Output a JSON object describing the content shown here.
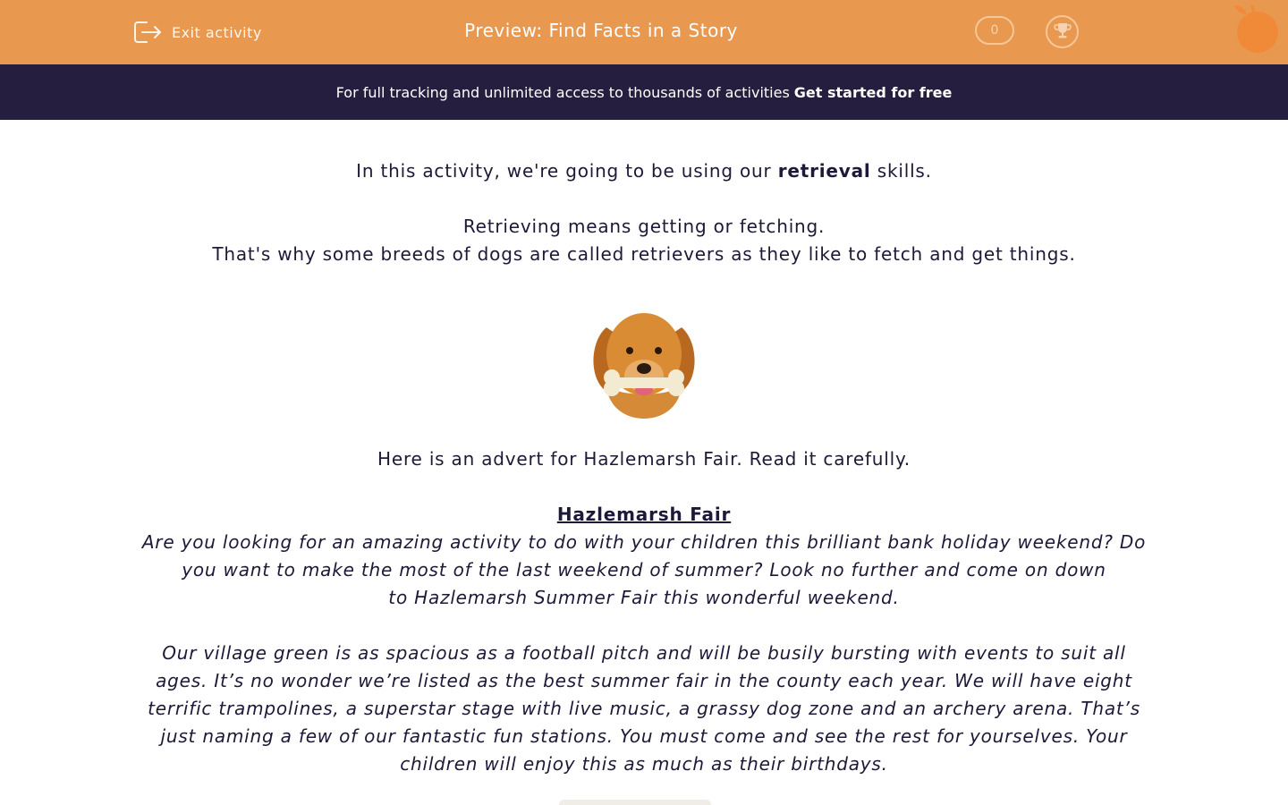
{
  "header": {
    "exit_label": "Exit activity",
    "title": "Preview: Find Facts in a Story",
    "score": "0"
  },
  "banner": {
    "text": "For full tracking and unlimited access to thousands of activities",
    "cta": "Get started for free"
  },
  "intro": {
    "line1_before": "In this activity, we're going to be using our",
    "line1_bold": "retrieval",
    "line1_after": "skills.",
    "line2": "Retrieving means getting or fetching.",
    "line3": "That's why some breeds of dogs are called retrievers as they like to fetch and get things."
  },
  "advert": {
    "instruction": "Here is an advert for Hazlemarsh Fair. Read it carefully.",
    "heading": "Hazlemarsh Fair",
    "para1_l1": "Are you looking for an amazing activity to do with your children this brilliant bank holiday weekend? Do",
    "para1_l2": "you want to make the most of the last weekend of summer? Look no further and come on down",
    "para1_l3": "to Hazlemarsh Summer Fair this wonderful weekend.",
    "para2_l1": "Our village green is as spacious as a football pitch and will be busily bursting with events to suit all",
    "para2_l2": "ages. It’s no wonder we’re listed as the best summer fair in the county each year. We will have eight",
    "para2_l3": "terrific trampolines, a superstar stage with live music, a grassy dog zone and an archery arena. That’s",
    "para2_l4": "just naming a few of our fantastic fun stations. You must come and see the rest for yourselves. Your",
    "para2_l5": "children will enjoy this as much as their birthdays."
  },
  "colors": {
    "header_bg": "#e9984f",
    "banner_bg": "#251e3e",
    "text": "#1f1838"
  },
  "icons": [
    "exit-icon",
    "trophy-icon",
    "orange-logo-icon",
    "dog-image"
  ]
}
